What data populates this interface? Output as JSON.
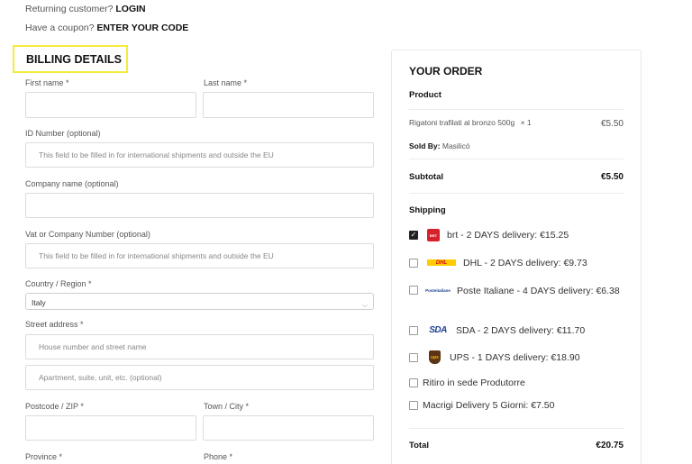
{
  "notices": {
    "returning_text": "Returning customer?",
    "login_link": "LOGIN",
    "coupon_text": "Have a coupon?",
    "coupon_link": "ENTER YOUR CODE"
  },
  "billing": {
    "heading": "BILLING DETAILS",
    "first_name_label": "First name *",
    "last_name_label": "Last name *",
    "id_label": "ID Number (optional)",
    "id_placeholder": "This field to be filled in for international shipments and outside the EU",
    "company_label": "Company name (optional)",
    "vat_label": "Vat or Company Number (optional)",
    "vat_placeholder": "This field to be filled in for international shipments and outside the EU",
    "country_label": "Country / Region *",
    "country_value": "Italy",
    "street_label": "Street address *",
    "street1_placeholder": "House number and street name",
    "street2_placeholder": "Apartment, suite, unit, etc. (optional)",
    "postcode_label": "Postcode / ZIP *",
    "town_label": "Town / City *",
    "province_label": "Province *",
    "phone_label": "Phone *"
  },
  "order": {
    "title": "YOUR ORDER",
    "product_heading": "Product",
    "item_name": "Rigatoni trafilati al bronzo 500g",
    "item_qty": "× 1",
    "item_price": "€5.50",
    "sold_by_label": "Sold By:",
    "sold_by_value": "Masilicò",
    "subtotal_label": "Subtotal",
    "subtotal_value": "€5.50",
    "shipping_heading": "Shipping",
    "shipping_options": [
      {
        "label": "brt - 2 DAYS delivery: €15.25",
        "checked": true,
        "icon": "brt-logo-icon"
      },
      {
        "label": "DHL - 2 DAYS delivery: €9.73",
        "checked": false,
        "icon": "dhl-logo-icon"
      },
      {
        "label": "Poste Italiane - 4 DAYS delivery: €6.38",
        "checked": false,
        "icon": "poste-italiane-logo-icon"
      },
      {
        "label": "SDA - 2 DAYS delivery: €11.70",
        "checked": false,
        "icon": "sda-logo-icon"
      },
      {
        "label": "UPS - 1 DAYS delivery: €18.90",
        "checked": false,
        "icon": "ups-logo-icon"
      },
      {
        "label": "Ritiro in sede Produtorre",
        "checked": false,
        "icon": ""
      },
      {
        "label": "Macrigi Delivery 5 Giorni: €7.50",
        "checked": false,
        "icon": ""
      }
    ],
    "total_label": "Total",
    "total_value": "€20.75"
  },
  "logos": {
    "brt_text": "BRT",
    "dhl_text": "DHL",
    "poste_text": "Posteitaliane",
    "sda_text": "SDA",
    "ups_text": "ups"
  },
  "colors": {
    "heading_highlight": "#f4ec3c",
    "brt_red": "#d6202a",
    "dhl_yellow": "#ffcc00",
    "dhl_red": "#d40511",
    "sda_blue": "#1f3f93",
    "ups_brown": "#5a3414",
    "ups_gold": "#f6b600"
  }
}
